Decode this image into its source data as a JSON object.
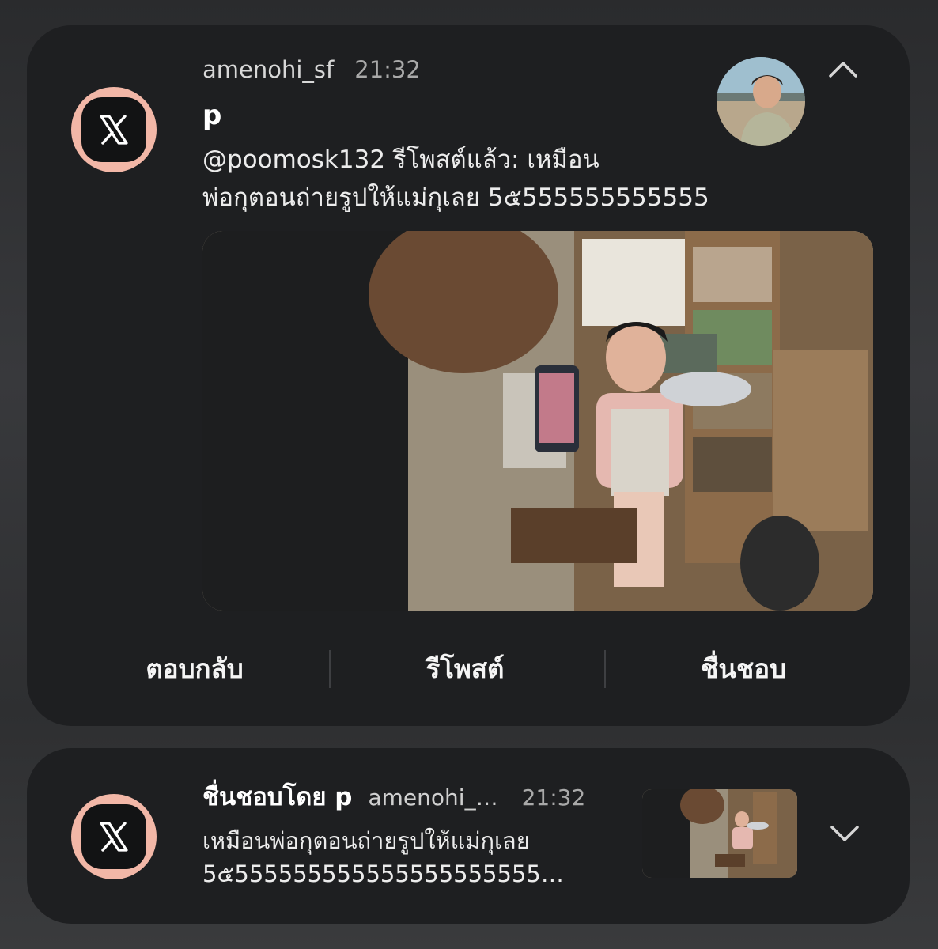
{
  "notification_main": {
    "app_icon": "x-logo-icon",
    "username": "amenohi_sf",
    "time": "21:32",
    "title": "p",
    "body_line1": "@poomosk132 รีโพสต์แล้ว: เหมือน",
    "body_line2": "พ่อกุตอนถ่ายรูปให้แม่กุเลย 5๕555555555555555…",
    "collapse_icon": "chevron-up-icon",
    "actions": [
      {
        "label": "ตอบกลับ"
      },
      {
        "label": "รีโพสต์"
      },
      {
        "label": "ชื่นชอบ"
      }
    ]
  },
  "notification_second": {
    "app_icon": "x-logo-icon",
    "title": "ชื่นชอบโดย p",
    "handle": "amenohi_…",
    "time": "21:32",
    "body_line1": "เหมือนพ่อกุตอนถ่ายรูปให้แม่กุเลย",
    "body_line2": "5๕555555555555555555555…",
    "expand_icon": "chevron-down-icon"
  },
  "colors": {
    "card_bg": "#1e1f21",
    "icon_ring": "#f2b7a7"
  }
}
